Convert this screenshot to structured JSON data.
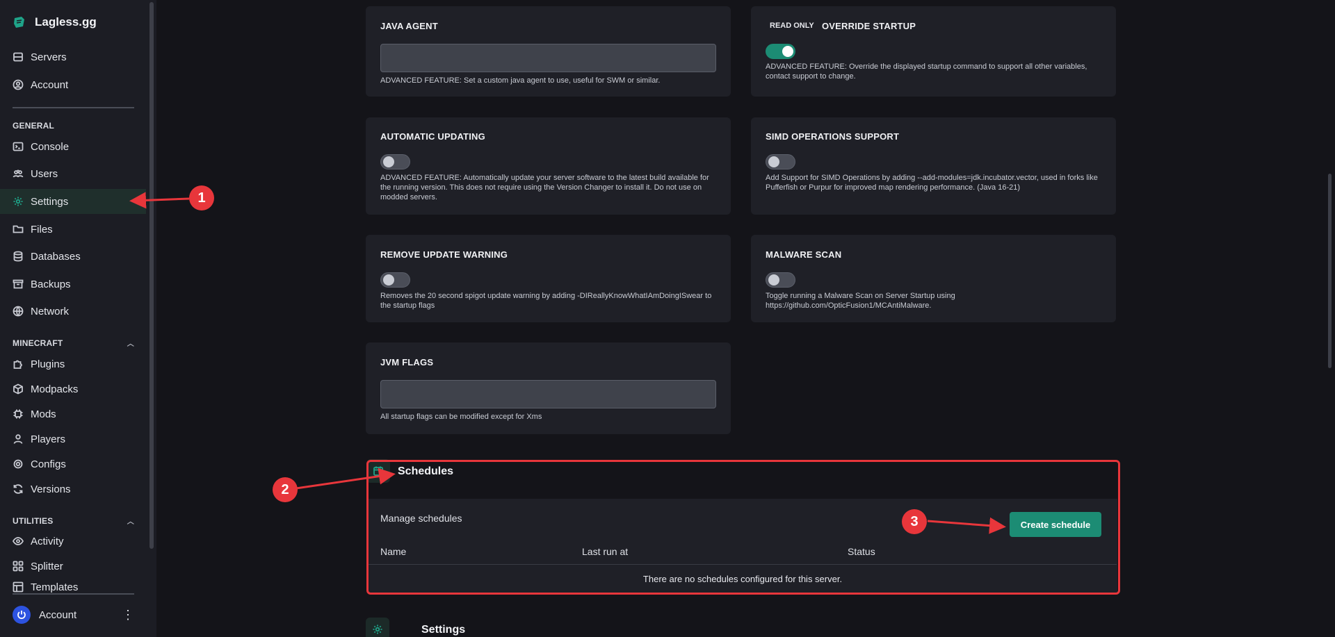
{
  "brand": {
    "name": "Lagless.gg"
  },
  "sidebar": {
    "top_items": [
      {
        "label": "Servers",
        "icon": "server-icon"
      },
      {
        "label": "Account",
        "icon": "user-circle-icon"
      }
    ],
    "general": {
      "title": "GENERAL",
      "items": [
        {
          "label": "Console",
          "icon": "terminal-icon"
        },
        {
          "label": "Users",
          "icon": "users-icon"
        },
        {
          "label": "Settings",
          "icon": "gear-icon",
          "active": true
        },
        {
          "label": "Files",
          "icon": "folder-icon"
        },
        {
          "label": "Databases",
          "icon": "database-icon"
        },
        {
          "label": "Backups",
          "icon": "archive-icon"
        },
        {
          "label": "Network",
          "icon": "globe-icon"
        }
      ]
    },
    "minecraft": {
      "title": "MINECRAFT",
      "items": [
        {
          "label": "Plugins",
          "icon": "puzzle-icon"
        },
        {
          "label": "Modpacks",
          "icon": "cube-icon"
        },
        {
          "label": "Mods",
          "icon": "chip-icon"
        },
        {
          "label": "Players",
          "icon": "person-icon"
        },
        {
          "label": "Configs",
          "icon": "cog-icon"
        },
        {
          "label": "Versions",
          "icon": "refresh-icon"
        }
      ]
    },
    "utilities": {
      "title": "UTILITIES",
      "items": [
        {
          "label": "Activity",
          "icon": "eye-icon"
        },
        {
          "label": "Splitter",
          "icon": "split-icon"
        },
        {
          "label": "Templates",
          "icon": "template-icon"
        }
      ]
    },
    "account": {
      "label": "Account",
      "menu": "⋮"
    }
  },
  "cards": {
    "java_agent": {
      "title": "JAVA AGENT",
      "value": "",
      "desc": "ADVANCED FEATURE: Set a custom java agent to use, useful for SWM or similar."
    },
    "override_startup": {
      "badge": "READ ONLY",
      "title": "OVERRIDE STARTUP",
      "enabled": true,
      "desc": "ADVANCED FEATURE: Override the displayed startup command to support all other variables, contact support to change."
    },
    "automatic_updating": {
      "title": "AUTOMATIC UPDATING",
      "enabled": false,
      "desc": "ADVANCED FEATURE: Automatically update your server software to the latest build available for the running version. This does not require using the Version Changer to install it. Do not use on modded servers."
    },
    "simd": {
      "title": "SIMD OPERATIONS SUPPORT",
      "enabled": false,
      "desc": "Add Support for SIMD Operations by adding --add-modules=jdk.incubator.vector, used in forks like Pufferfish or Purpur for improved map rendering performance. (Java 16-21)"
    },
    "remove_update_warning": {
      "title": "REMOVE UPDATE WARNING",
      "enabled": false,
      "desc": "Removes the 20 second spigot update warning by adding -DIReallyKnowWhatIAmDoingISwear to the startup flags"
    },
    "malware_scan": {
      "title": "MALWARE SCAN",
      "enabled": false,
      "desc": "Toggle running a Malware Scan on Server Startup using https://github.com/OpticFusion1/MCAntiMalware."
    },
    "jvm_flags": {
      "title": "JVM FLAGS",
      "value": "",
      "desc": "All startup flags can be modified except for Xms"
    }
  },
  "schedules": {
    "title": "Schedules",
    "subtitle": "Manage schedules",
    "create_label": "Create schedule",
    "columns": [
      "Name",
      "Last run at",
      "Status"
    ],
    "empty": "There are no schedules configured for this server."
  },
  "settings_section": {
    "title": "Settings"
  },
  "annotations": [
    "1",
    "2",
    "3"
  ],
  "colors": {
    "accent": "#1c8c74",
    "annotation": "#e8363b",
    "background": "#141419",
    "sidebar": "#1c1d24",
    "card": "#1f2027"
  }
}
